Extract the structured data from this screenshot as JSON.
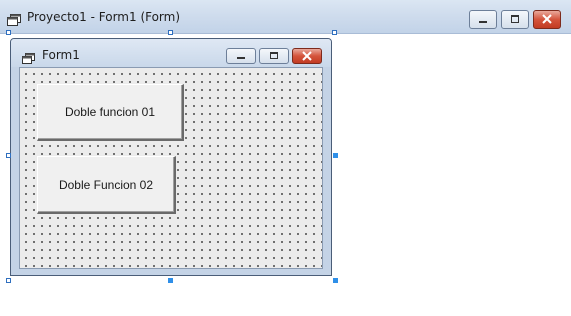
{
  "outer_window": {
    "title": "Proyecto1 - Form1 (Form)",
    "icon": "form-window-icon",
    "controls": [
      "minimize",
      "restore",
      "close"
    ]
  },
  "form": {
    "title": "Form1",
    "icon": "form-window-icon",
    "controls": [
      "minimize",
      "restore",
      "close"
    ],
    "buttons": [
      {
        "label": "Doble funcion 01"
      },
      {
        "label": "Doble Funcion 02"
      }
    ]
  },
  "colors": {
    "selection_handle": "#2f8fe8",
    "close_button": "#c23b22",
    "form_client": "#ececec"
  }
}
